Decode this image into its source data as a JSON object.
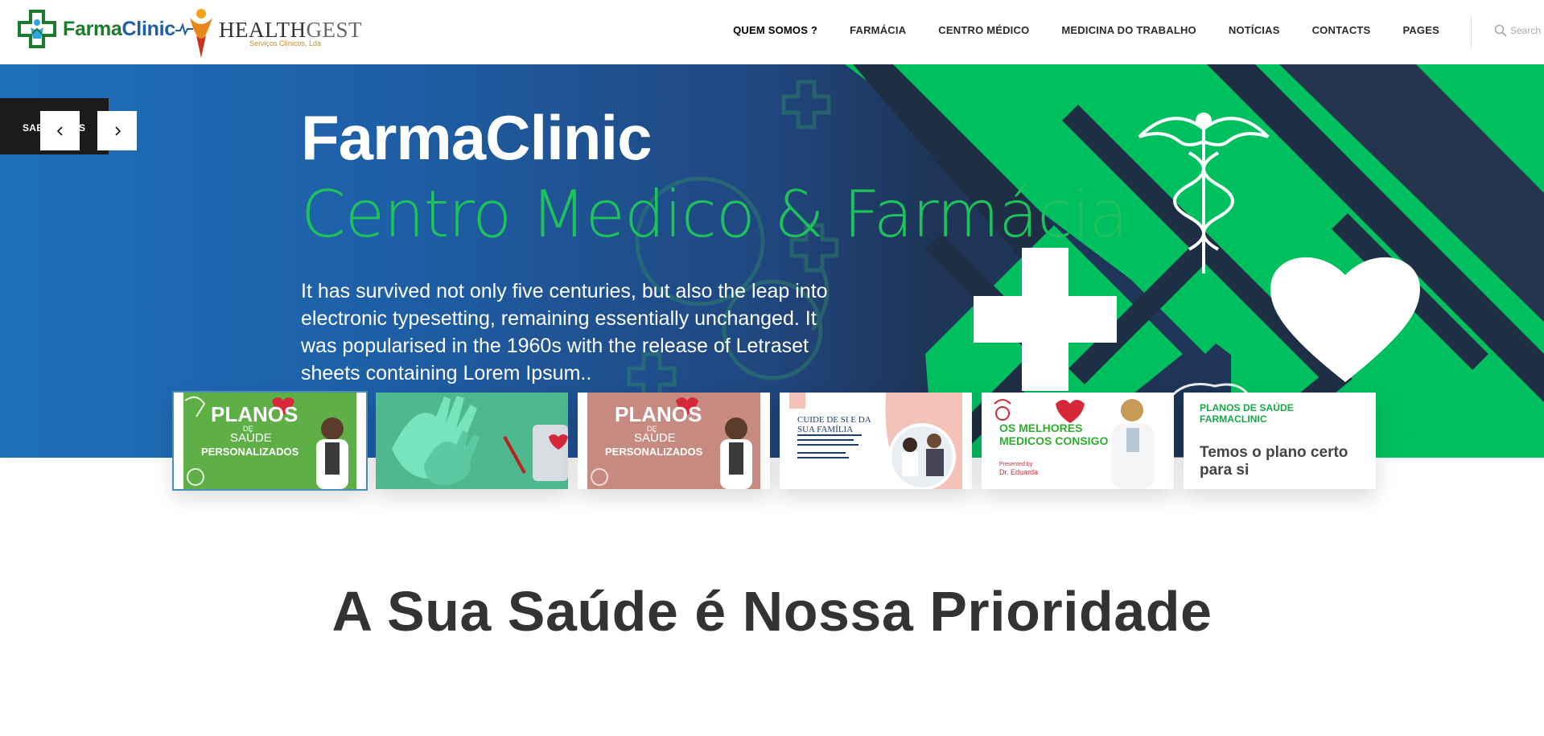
{
  "header": {
    "brand_farma_green": "Farma",
    "brand_farma_blue": "Clinic",
    "brand_hg_main": "HEALTH",
    "brand_hg_thin": "GEST",
    "brand_hg_tagline": "Serviços Clínicos, Lda"
  },
  "nav": {
    "items": [
      {
        "label": "QUEM SOMOS ?"
      },
      {
        "label": "FARMÁCIA"
      },
      {
        "label": "CENTRO MÉDICO"
      },
      {
        "label": "MEDICINA DO TRABALHO"
      },
      {
        "label": "NOTÍCIAS"
      },
      {
        "label": "CONTACTS"
      },
      {
        "label": "PAGES"
      }
    ]
  },
  "search": {
    "placeholder": "Search",
    "icon": "search-icon"
  },
  "hero": {
    "tag": "SABER MAIS",
    "title": "FarmaClinic",
    "subtitle": "Centro Medico & Farmácia",
    "text": "It has survived not only five centuries, but also the leap into electronic typesetting, remaining essentially unchanged. It was popularised in the 1960s with the release of Letraset sheets containing Lorem Ipsum..",
    "prev_icon": "chevron-left-icon",
    "next_icon": "chevron-right-icon"
  },
  "cards": {
    "c1": {
      "t1": "PLANOS",
      "t2": "DE",
      "t3": "SAÚDE",
      "t4": "PERSONALIZADOS"
    },
    "c3": {
      "t1": "PLANOS",
      "t2": "DE",
      "t3": "SAÚDE",
      "t4": "PERSONALIZADOS"
    },
    "c4": {
      "t1": "CUIDE DE SI E DA",
      "t2": "SUA FAMÍLIA"
    },
    "c5": {
      "t1": "OS MELHORES",
      "t2": "MEDICOS CONSIGO",
      "t3": "Presented by",
      "t4": "Dr. Eduarda"
    },
    "c6": {
      "label": "PLANOS DE SAÚDE FARMACLINIC",
      "title": "Temos o plano certo para si"
    }
  },
  "main": {
    "heading": "A Sua Saúde é Nossa Prioridade"
  },
  "colors": {
    "green": "#00bf5f",
    "brand_green": "#1b7a2b",
    "dark": "#1e3558",
    "accent_blue": "#1f6fba"
  }
}
